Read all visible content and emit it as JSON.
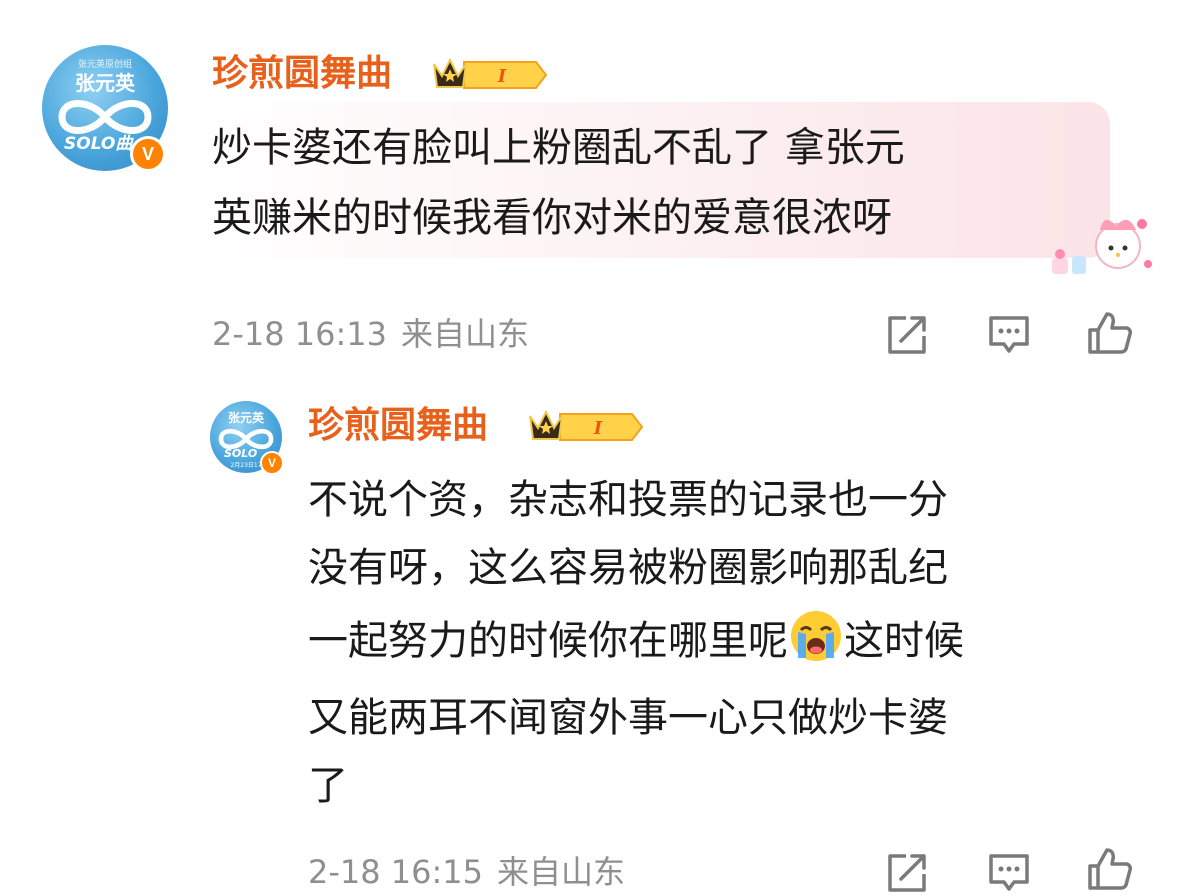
{
  "comment": {
    "avatar": {
      "top_text": "张元英原创组",
      "name": "张元英",
      "solo": "SOLO曲"
    },
    "verified_badge": "V",
    "username": "珍煎圆舞曲",
    "level": "I",
    "text_lines": [
      "炒卡婆还有脸叫上粉圈乱不乱了 拿张元",
      "英赚米的时候我看你对米的爱意很浓呀"
    ],
    "time": "2-18 16:13",
    "location": "来自山东",
    "icons": [
      "share-icon",
      "comment-icon",
      "like-icon"
    ]
  },
  "reply": {
    "avatar": {
      "name": "张元英",
      "solo": "SOLO",
      "date": "2月23日17"
    },
    "verified_badge": "V",
    "username": "珍煎圆舞曲",
    "level": "I",
    "text_lines": [
      "不说个资，杂志和投票的记录也一分",
      "没有呀，这么容易被粉圈影响那乱纪",
      "一起努力的时候你在哪里呢",
      "这时候",
      "又能两耳不闻窗外事一心只做炒卡婆",
      "了"
    ],
    "emoji": "loudly-crying-emoji",
    "time": "2-18 16:15",
    "location": "来自山东",
    "icons": [
      "share-icon",
      "comment-icon",
      "like-icon"
    ]
  },
  "colors": {
    "username": "#e8611c",
    "meta": "#8f8f8f",
    "vip_badge": "#ff8200",
    "avatar_blue": "#4ba6dc"
  }
}
